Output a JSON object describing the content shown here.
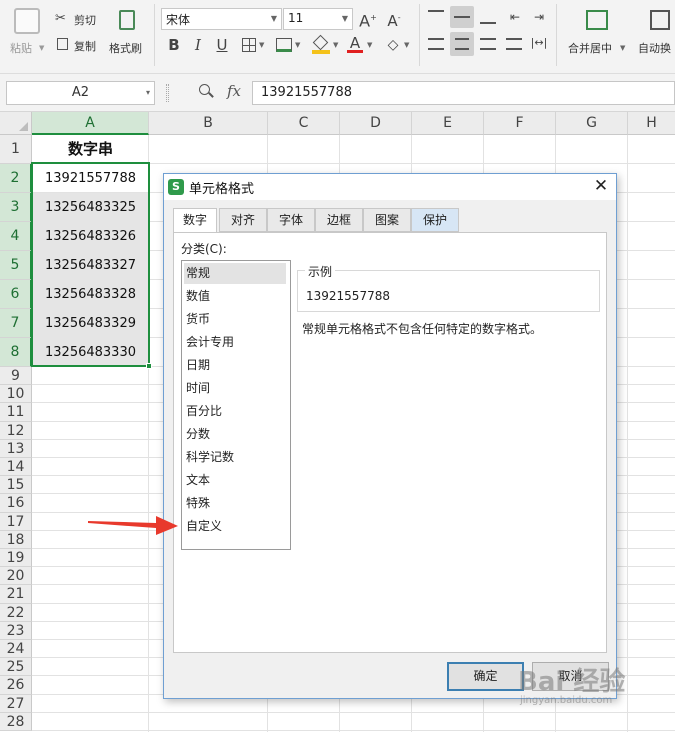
{
  "toolbar": {
    "paste": "粘贴",
    "cut": "剪切",
    "copy": "复制",
    "format_painter": "格式刷",
    "font_name": "宋体",
    "font_size": "11",
    "merge_center": "合并居中",
    "auto_wrap": "自动换"
  },
  "formula_bar": {
    "name_box": "A2",
    "fx": "fx",
    "value": "13921557788"
  },
  "sheet": {
    "columns": [
      "A",
      "B",
      "C",
      "D",
      "E",
      "F",
      "G",
      "H"
    ],
    "rows": [
      "1",
      "2",
      "3",
      "4",
      "5",
      "6",
      "7",
      "8",
      "9",
      "10",
      "11",
      "12",
      "13",
      "14",
      "15",
      "16",
      "17",
      "18",
      "19",
      "20",
      "21",
      "22",
      "23",
      "24",
      "25",
      "26",
      "27",
      "28"
    ],
    "a_cells": [
      "数字串",
      "13921557788",
      "13256483325",
      "13256483326",
      "13256483327",
      "13256483328",
      "13256483329",
      "13256483330"
    ]
  },
  "dialog": {
    "title": "单元格格式",
    "tabs": [
      "数字",
      "对齐",
      "字体",
      "边框",
      "图案",
      "保护"
    ],
    "category_label": "分类(C):",
    "categories": [
      "常规",
      "数值",
      "货币",
      "会计专用",
      "日期",
      "时间",
      "百分比",
      "分数",
      "科学记数",
      "文本",
      "特殊",
      "自定义"
    ],
    "sample_label": "示例",
    "sample_value": "13921557788",
    "description": "常规单元格格式不包含任何特定的数字格式。",
    "ok": "确定",
    "cancel": "取消"
  },
  "watermark": {
    "text": "Bai 经验",
    "sub": "jingyan.baidu.com"
  },
  "colors": {
    "selection": "#1e8e3e",
    "dialog_border": "#6f9fd2",
    "ok_border": "#3c7fb1",
    "arrow": "#e8392c"
  }
}
